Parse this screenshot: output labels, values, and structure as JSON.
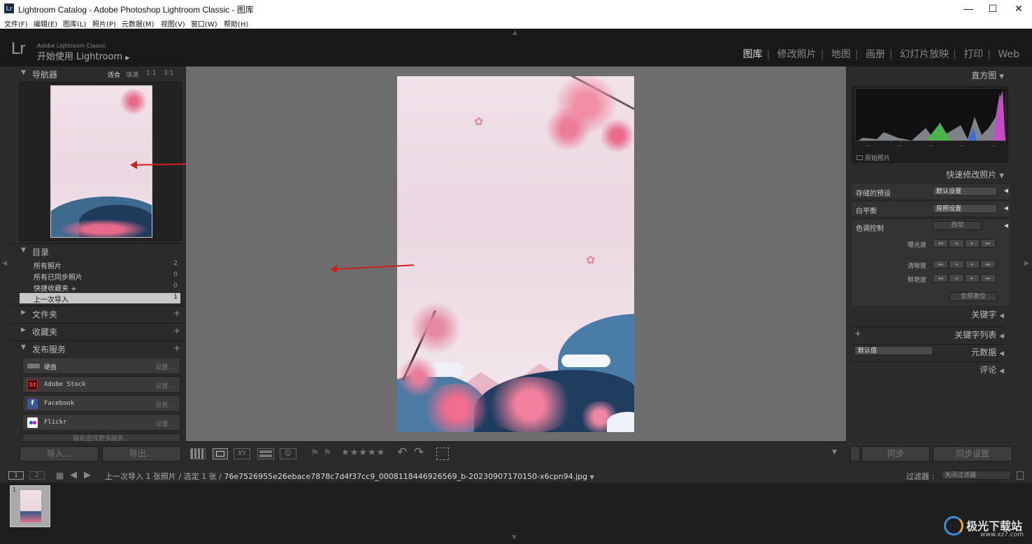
{
  "window": {
    "title": "Lightroom Catalog - Adobe Photoshop Lightroom Classic - 图库",
    "app_icon": "Lr",
    "minimize": "—",
    "maximize": "☐",
    "close": "✕"
  },
  "menu": [
    "文件(F)",
    "编辑(E)",
    "图库(L)",
    "照片(P)",
    "元数据(M)",
    "视图(V)",
    "窗口(W)",
    "帮助(H)"
  ],
  "identity": {
    "logo": "Lr",
    "subtitle": "Adobe Lightroom Classic",
    "title": "开始使用 Lightroom",
    "arrow": "▶"
  },
  "modules": [
    {
      "label": "图库",
      "active": true
    },
    {
      "label": "修改照片"
    },
    {
      "label": "地图"
    },
    {
      "label": "画册"
    },
    {
      "label": "幻灯片放映"
    },
    {
      "label": "打印"
    },
    {
      "label": "Web"
    }
  ],
  "navigator": {
    "title": "导航器",
    "zoom": [
      "适合",
      "填满",
      "1:1",
      "3:1"
    ]
  },
  "catalog": {
    "title": "目录",
    "items": [
      {
        "label": "所有照片",
        "count": "2"
      },
      {
        "label": "所有已同步照片",
        "count": "0"
      },
      {
        "label": "快捷收藏夹 +",
        "count": "0"
      },
      {
        "label": "上一次导入",
        "count": "1",
        "selected": true
      }
    ]
  },
  "folders": {
    "title": "文件夹"
  },
  "collections": {
    "title": "收藏夹"
  },
  "publish": {
    "title": "发布服务",
    "services": [
      {
        "name": "硬盘",
        "settings": "设置...",
        "icon": "harddisk-icon"
      },
      {
        "name": "Adobe Stock",
        "settings": "设置...",
        "icon": "St",
        "color": "#da1f26"
      },
      {
        "name": "Facebook",
        "settings": "设置...",
        "icon": "f",
        "color": "#3b5998"
      },
      {
        "name": "Flickr",
        "settings": "设置...",
        "icon": "flickr-icon"
      }
    ],
    "more": "联机查找更多服务..."
  },
  "left_buttons": {
    "import": "导入...",
    "export": "导出..."
  },
  "histogram": {
    "title": "直方图",
    "original": "原始照片",
    "ticks": [
      "—",
      "—",
      "—",
      "—",
      "—"
    ]
  },
  "quick_develop": {
    "title": "快速修改照片",
    "saved_preset_label": "存储的预设",
    "saved_preset_value": "默认设置",
    "wb_label": "白平衡",
    "wb_value": "原照设置",
    "tone_label": "色调控制",
    "auto": "自动",
    "exposure": "曝光度",
    "clarity": "清晰度",
    "vibrance": "鲜艳度",
    "reset": "全部复位",
    "stepper": [
      "◂◂",
      "◂",
      "▸",
      "▸▸"
    ]
  },
  "keywords": {
    "title": "关键字"
  },
  "keyword_list": {
    "title": "关键字列表",
    "plus": "+"
  },
  "metadata": {
    "title": "元数据",
    "preset": "默认值"
  },
  "comments": {
    "title": "评论"
  },
  "right_buttons": {
    "sync": "同步",
    "sync_settings": "同步设置"
  },
  "toolbar": {
    "stars": "★★★★★"
  },
  "filmstrip": {
    "page1": "1",
    "page2": "2",
    "source": "上一次导入",
    "count": "1 张照片 / 选定 1 张 /",
    "filename": "76e7526955e26ebace7878c7d4f37cc9_0008118446926569_b-20230907170150-x6cpn94.jpg",
    "filter_label": "过滤器 :",
    "filter_value": "关闭过滤器",
    "thumb_index": "1"
  },
  "watermark": {
    "text": "极光下载站",
    "url": "www.xz7.com"
  }
}
